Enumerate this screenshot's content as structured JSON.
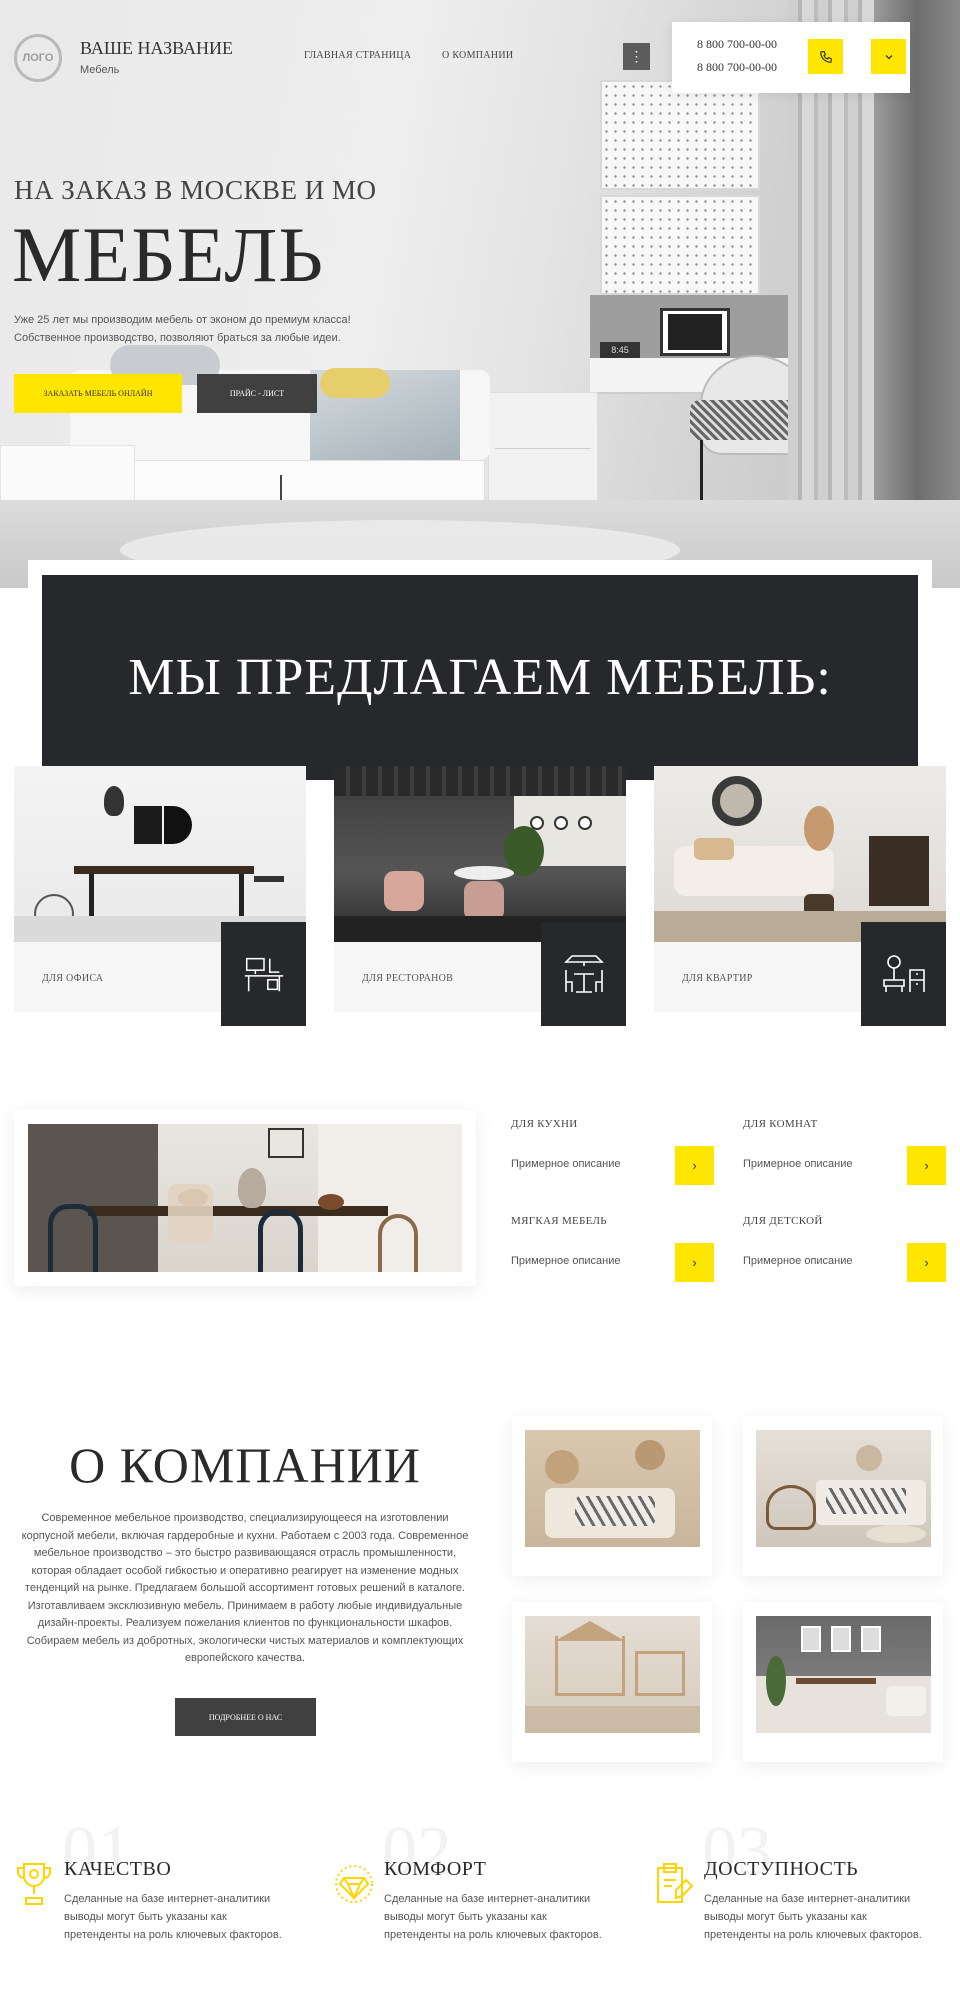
{
  "header": {
    "logo_text": "ЛОГО",
    "brand_name": "ВАШЕ НАЗВАНИЕ",
    "brand_sub": "Мебель",
    "nav": [
      "ГЛАВНАЯ СТРАНИЦА",
      "О КОМПАНИИ"
    ],
    "menu_icon": "⋮",
    "phones": [
      "8 800 700-00-00",
      "8 800 700-00-00"
    ],
    "icons": [
      "phone-icon",
      "chevron-down-icon"
    ]
  },
  "hero": {
    "subtitle": "НА ЗАКАЗ В МОСКВЕ И МО",
    "title": "МЕБЕЛЬ",
    "description": "Уже 25 лет мы производим мебель от эконом до премиум класса! Собственное производство, позволяют браться за любые идеи.",
    "btn_order": "ЗАКАЗАТЬ МЕБЕЛЬ ОНЛАЙН",
    "btn_price": "ПРАЙС - ЛИСТ",
    "screen_text": "8:45"
  },
  "offer": {
    "title": "МЫ ПРЕДЛАГАЕМ МЕБЕЛЬ:",
    "categories": [
      {
        "label": "ДЛЯ ОФИСА",
        "icon": "office-desk-icon"
      },
      {
        "label": "ДЛЯ РЕСТОРАНОВ",
        "icon": "restaurant-table-icon"
      },
      {
        "label": "ДЛЯ КВАРТИР",
        "icon": "apartment-furniture-icon"
      }
    ]
  },
  "products": [
    {
      "title": "ДЛЯ КУХНИ",
      "desc": "Примерное описание",
      "btn": "›"
    },
    {
      "title": "ДЛЯ КОМНАТ",
      "desc": "Примерное описание",
      "btn": "›"
    },
    {
      "title": "МЯГКАЯ МЕБЕЛЬ",
      "desc": "Примерное описание",
      "btn": "›"
    },
    {
      "title": "ДЛЯ ДЕТСКОЙ",
      "desc": "Примерное описание",
      "btn": "›"
    }
  ],
  "about": {
    "title": "О КОМПАНИИ",
    "text": "Современное мебельное производство, специализирующееся на изготовлении корпусной мебели, включая гардеробные и кухни. Работаем с 2003 года. Современное мебельное производство – это быстро развивающаяся отрасль промышленности, которая обладает особой гибкостью и оперативно реагирует на изменение модных тенденций на рынке. Предлагаем большой ассортимент готовых решений в каталоге. Изготавливаем эксклюзивную мебель. Принимаем в работу любые индивидуальные дизайн-проекты. Реализуем пожелания клиентов по функциональности шкафов. Собираем мебель из добротных, экологически чистых материалов и комплектующих европейского качества.",
    "button": "ПОДРОБНЕЕ О НАС"
  },
  "features": [
    {
      "num": "01",
      "title": "КАЧЕСТВО",
      "text": "Сделанные на базе интернет-аналитики выводы могут быть указаны как претенденты на роль ключевых факторов.",
      "icon": "trophy-icon"
    },
    {
      "num": "02",
      "title": "КОМФОРТ",
      "text": "Сделанные на базе интернет-аналитики выводы могут быть указаны как претенденты на роль ключевых факторов.",
      "icon": "diamond-icon"
    },
    {
      "num": "03",
      "title": "ДОСТУПНОСТЬ",
      "text": "Сделанные на базе интернет-аналитики выводы могут быть указаны как претенденты на роль ключевых факторов.",
      "icon": "price-tag-icon"
    }
  ],
  "colors": {
    "accent": "#ffe600",
    "dark": "#27282c",
    "button_dark": "#404040"
  }
}
